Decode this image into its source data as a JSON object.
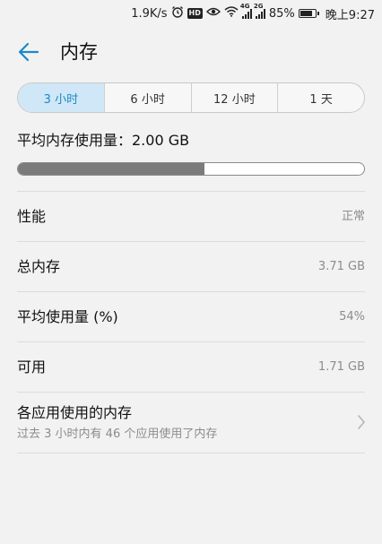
{
  "status_bar": {
    "net_speed": "1.9K/s",
    "signal1_label": "4G",
    "signal2_label": "2G",
    "battery_text": "85%",
    "battery_level": 0.85,
    "time": "晚上9:27",
    "icons": [
      "alarm-icon",
      "hd-icon",
      "eye-icon",
      "wifi-icon",
      "signal-icon",
      "signal-icon",
      "battery-icon"
    ]
  },
  "title_bar": {
    "title": "内存",
    "back_icon": "arrow-left-icon",
    "accent_color": "#1e88c8"
  },
  "time_range": {
    "options": [
      "3 小时",
      "6 小时",
      "12 小时",
      "1 天"
    ],
    "selected_index": 0
  },
  "average_usage": {
    "label": "平均内存使用量：2.00 GB",
    "fraction_used": 0.54
  },
  "rows": [
    {
      "label": "性能",
      "value": "正常"
    },
    {
      "label": "总内存",
      "value": "3.71 GB"
    },
    {
      "label": "平均使用量 (%)",
      "value": "54%"
    },
    {
      "label": "可用",
      "value": "1.71 GB"
    }
  ],
  "app_usage": {
    "title": "各应用使用的内存",
    "subtitle": "过去 3 小时内有 46 个应用使用了内存",
    "chevron_icon": "chevron-right-icon"
  }
}
